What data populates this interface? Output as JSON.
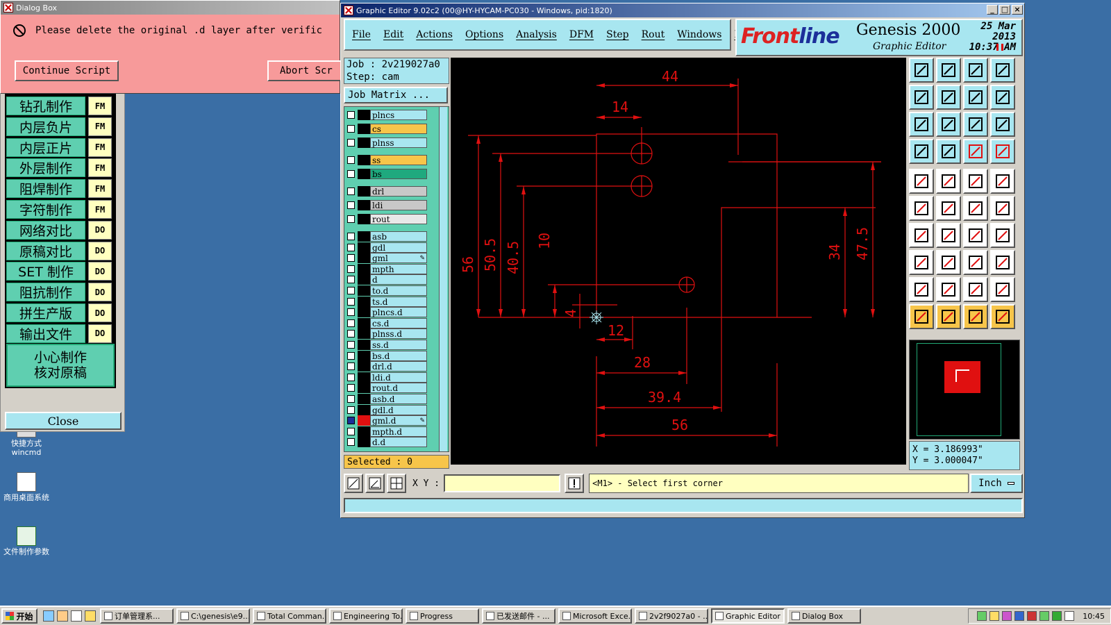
{
  "dialog": {
    "title": "Dialog Box",
    "message": "Please delete the original .d layer after verific",
    "continue_label": "Continue Script",
    "abort_label": "Abort Scr"
  },
  "left_panel": {
    "rows": [
      {
        "label": "钻孔制作",
        "code": "FM"
      },
      {
        "label": "内层负片",
        "code": "FM"
      },
      {
        "label": "内层正片",
        "code": "FM"
      },
      {
        "label": "外层制作",
        "code": "FM"
      },
      {
        "label": "阻焊制作",
        "code": "FM"
      },
      {
        "label": "字符制作",
        "code": "FM"
      },
      {
        "label": "网络对比",
        "code": "DO"
      },
      {
        "label": "原稿对比",
        "code": "DO"
      },
      {
        "label": "SET 制作",
        "code": "DO"
      },
      {
        "label": "阻抗制作",
        "code": "DO"
      },
      {
        "label": "拼生产版",
        "code": "DO"
      },
      {
        "label": "输出文件",
        "code": "DO"
      }
    ],
    "big_line1": "小心制作",
    "big_line2": "核对原稿",
    "close_label": "Close"
  },
  "desktop_icons": [
    {
      "label": "快捷方式 wincmd"
    },
    {
      "label": "商用桌面系统"
    },
    {
      "label": "文件制作参数"
    }
  ],
  "editor": {
    "title": "Graphic Editor 9.02c2 (00@HY-HYCAM-PC030 - Windows, pid:1820)",
    "menu": [
      "File",
      "Edit",
      "Actions",
      "Options",
      "Analysis",
      "DFM",
      "Step",
      "Rout",
      "Windows",
      "Help"
    ],
    "brand": {
      "logo_a": "Front",
      "logo_b": "line",
      "product": "Genesis 2000",
      "subtitle": "Graphic Editor",
      "date": "25 Mar 2013",
      "time": "10:37 AM"
    },
    "job": "Job : 2v219027a0",
    "step": "Step: cam",
    "job_matrix": "Job Matrix ...",
    "layers": [
      {
        "name": "plncs",
        "color": "#000000",
        "bg": "#a8e6f0"
      },
      {
        "name": "cs",
        "color": "#000000",
        "bg": "#f7c54a"
      },
      {
        "name": "plnss",
        "color": "#000000",
        "bg": "#a8e6f0"
      },
      {
        "name": "ss",
        "color": "#000000",
        "bg": "#f7c54a"
      },
      {
        "name": "bs",
        "color": "#000000",
        "bg": "#1fa97e"
      },
      {
        "name": "drl",
        "color": "#000000",
        "bg": "#c8c8c8"
      },
      {
        "name": "ldi",
        "color": "#000000",
        "bg": "#c8c8c8"
      },
      {
        "name": "rout",
        "color": "#000000",
        "bg": "#e8e8e8"
      },
      {
        "name": "asb",
        "color": "#000000",
        "bg": "#a8e6f0"
      },
      {
        "name": "gdl",
        "color": "#000000",
        "bg": "#a8e6f0"
      },
      {
        "name": "gml",
        "color": "#000000",
        "bg": "#a8e6f0"
      },
      {
        "name": "mpth",
        "color": "#000000",
        "bg": "#a8e6f0"
      },
      {
        "name": "d",
        "color": "#000000",
        "bg": "#a8e6f0"
      },
      {
        "name": "to.d",
        "color": "#000000",
        "bg": "#a8e6f0"
      },
      {
        "name": "ts.d",
        "color": "#000000",
        "bg": "#a8e6f0"
      },
      {
        "name": "plncs.d",
        "color": "#000000",
        "bg": "#a8e6f0"
      },
      {
        "name": "cs.d",
        "color": "#000000",
        "bg": "#a8e6f0"
      },
      {
        "name": "plnss.d",
        "color": "#000000",
        "bg": "#a8e6f0"
      },
      {
        "name": "ss.d",
        "color": "#000000",
        "bg": "#a8e6f0"
      },
      {
        "name": "bs.d",
        "color": "#000000",
        "bg": "#a8e6f0"
      },
      {
        "name": "drl.d",
        "color": "#000000",
        "bg": "#a8e6f0"
      },
      {
        "name": "ldi.d",
        "color": "#000000",
        "bg": "#a8e6f0"
      },
      {
        "name": "rout.d",
        "color": "#000000",
        "bg": "#a8e6f0"
      },
      {
        "name": "asb.d",
        "color": "#000000",
        "bg": "#a8e6f0"
      },
      {
        "name": "gdl.d",
        "color": "#000000",
        "bg": "#a8e6f0"
      },
      {
        "name": "gml.d",
        "color": "#e01010",
        "bg": "#a8e6f0"
      },
      {
        "name": "mpth.d",
        "color": "#000000",
        "bg": "#a8e6f0"
      },
      {
        "name": "d.d",
        "color": "#000000",
        "bg": "#a8e6f0"
      }
    ],
    "selected": "Selected : 0",
    "dimensions": [
      "44",
      "14",
      "56",
      "50.5",
      "40.5",
      "10",
      "4",
      "12",
      "28",
      "39.4",
      "56",
      "34",
      "47.5"
    ],
    "coords": {
      "x": "X = 3.186993\"",
      "y": "Y = 3.000047\""
    },
    "xy_label": "X Y :",
    "prompt": "<M1> - Select first corner",
    "unit": "Inch"
  },
  "taskbar": {
    "start": "开始",
    "tasks": [
      "订单管理系...",
      "C:\\genesis\\e9...",
      "Total Comman...",
      "Engineering To...",
      "Progress",
      "已发送邮件 - ...",
      "Microsoft Exce...",
      "2v2f9027a0 - ...",
      "Graphic Editor ...",
      "Dialog Box"
    ],
    "clock": "10:45"
  },
  "colors": {
    "desktop": "#3a6ea5",
    "panel_cyan": "#a8e6f0",
    "panel_green": "#5fcfb0",
    "dialog_pink": "#f79a9a",
    "drawing_red": "#e01010",
    "highlight_yellow": "#f7c54a"
  }
}
